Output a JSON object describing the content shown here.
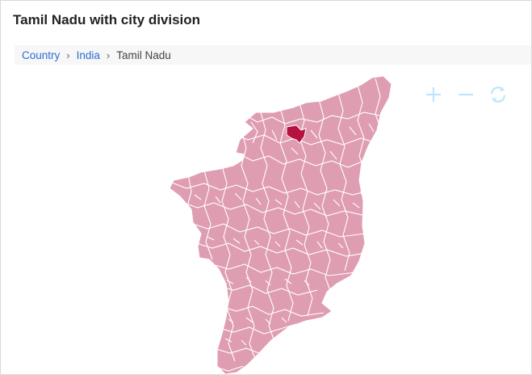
{
  "title": "Tamil Nadu with city division",
  "breadcrumb": {
    "items": [
      {
        "label": "Country",
        "link": true
      },
      {
        "label": "India",
        "link": true
      },
      {
        "label": "Tamil Nadu",
        "link": false
      }
    ]
  },
  "map": {
    "region": "Tamil Nadu",
    "fill_color": "#df9db2",
    "border_color": "#ffffff",
    "highlight_color": "#b5123f"
  },
  "toolbar": {
    "icons": [
      "zoom-in-icon",
      "zoom-out-icon",
      "reset-icon"
    ],
    "icon_color": "#bfe7fb"
  }
}
